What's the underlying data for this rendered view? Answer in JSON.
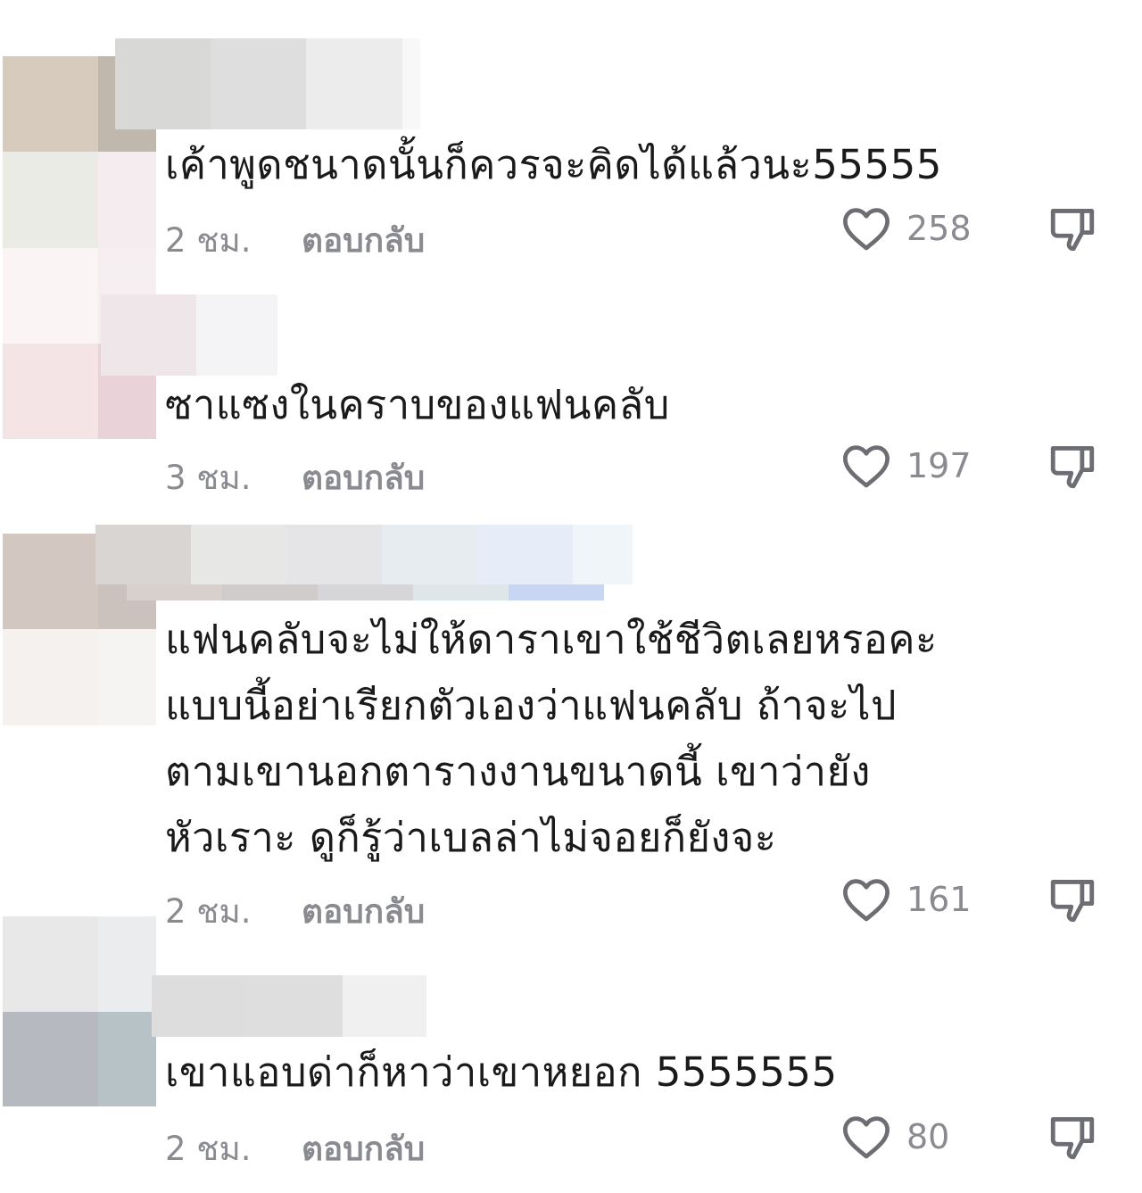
{
  "comments": [
    {
      "text": "เค้าพูดชนาดนั้นก็ควรจะคิดได้แล้วนะ55555",
      "time": "2 ชม.",
      "reply_label": "ตอบกลับ",
      "likes": "258"
    },
    {
      "text": "ซาแซงในคราบของแฟนคลับ",
      "time": "3 ชม.",
      "reply_label": "ตอบกลับ",
      "likes": "197"
    },
    {
      "text": "แฟนคลับจะไม่ให้ดาราเขาใช้ชีวิตเลยหรอคะ\nแบบนี้อย่าเรียกตัวเองว่าแฟนคลับ ถ้าจะไป\nตามเขานอกตารางงานขนาดนี้ เขาว่ายัง\nหัวเราะ ดูก็รู้ว่าเบลล่าไม่จอยก็ยังจะ",
      "time": "2 ชม.",
      "reply_label": "ตอบกลับ",
      "likes": "161"
    },
    {
      "text": "เขาแอบด่าก็หาว่าเขาหยอก 5555555",
      "time": "2 ชม.",
      "reply_label": "ตอบกลับ",
      "likes": "80"
    }
  ],
  "icons": {
    "like": "heart-outline-icon",
    "dislike": "thumbs-down-outline-icon"
  },
  "colors": {
    "text": "#1a1a1a",
    "meta": "#8a8b91",
    "icon": "#6d6e73"
  },
  "redactions": [
    {
      "part": "avatar",
      "colors": [
        "#d6cbbd",
        "#c0b8ad",
        "#ebebe5",
        "#f4ecee",
        "#faf5f4",
        "#f6eff2"
      ]
    },
    {
      "part": "username",
      "colors": [
        "#d8d8d6",
        "#dedede",
        "#ececec",
        "#f8f8f8"
      ]
    },
    {
      "part": "avatar",
      "colors": [
        "#f4e4e6",
        "#f2e2e4",
        "#efe6ea",
        "#f4f4f6",
        "#e9d3d8"
      ]
    },
    {
      "part": "username",
      "colors": [
        "#d9d5d3",
        "#e7e7e6",
        "#e5e5e7",
        "#e6ecef",
        "#e6ecf8",
        "#f0f5fa"
      ]
    },
    {
      "part": "avatar",
      "colors": [
        "#d2c7c1",
        "#ccc2bd",
        "#f4f1ee",
        "#f5f4f2"
      ]
    },
    {
      "part": "avatar",
      "colors": [
        "#e8e8e9",
        "#ebeced",
        "#b7b9c0",
        "#b7c2c6"
      ]
    },
    {
      "part": "username",
      "colors": [
        "#dddddd",
        "#dedede",
        "#f0f0f0"
      ]
    }
  ]
}
